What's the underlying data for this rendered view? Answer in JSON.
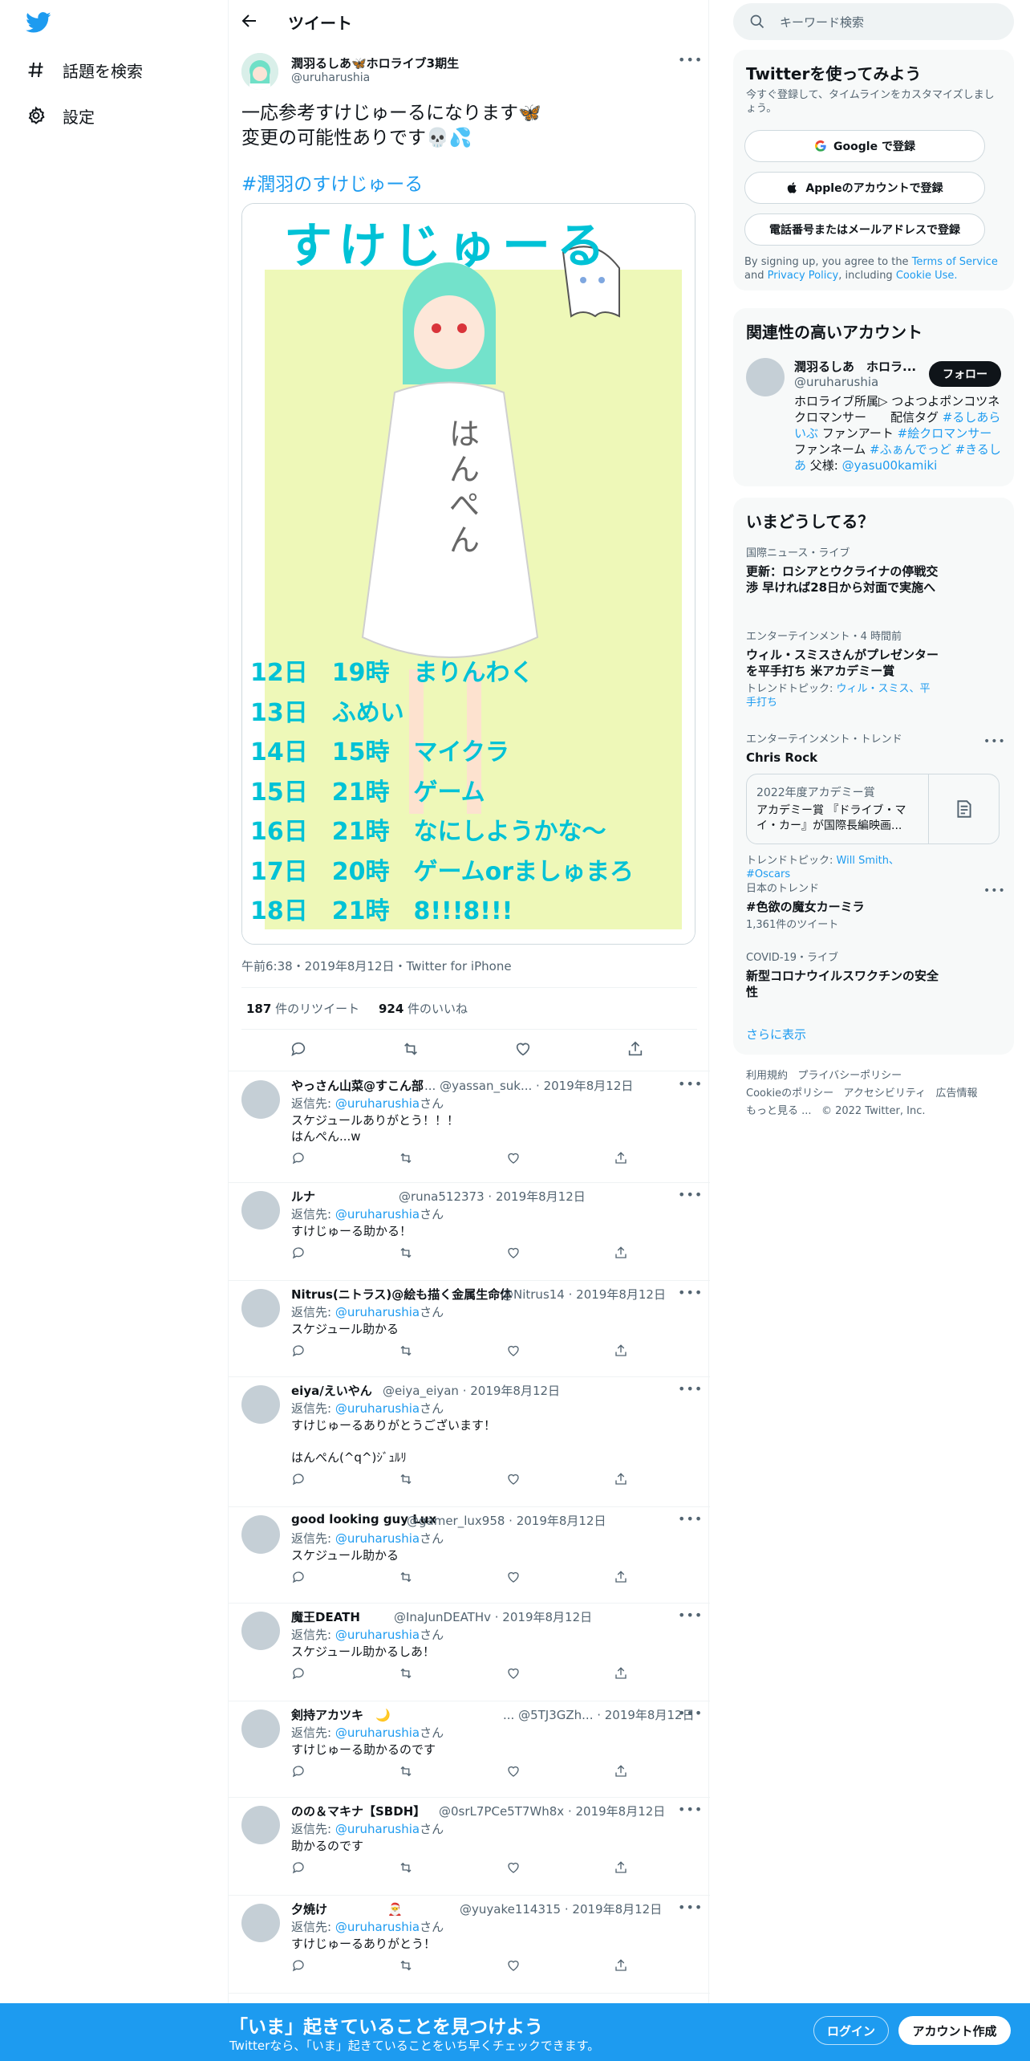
{
  "colors": {
    "accent": "#1d9bf0",
    "text": "#0f1419",
    "muted": "#536471",
    "schedule_text": "#00c2d6",
    "schedule_bg": "#eef8b8"
  },
  "nav": {
    "items": [
      {
        "label": "話題を検索",
        "icon": "hashtag-icon"
      },
      {
        "label": "設定",
        "icon": "gear-icon"
      }
    ]
  },
  "header": {
    "title": "ツイート"
  },
  "tweet": {
    "author_name": "潤羽るしあ🦋ホロライブ3期生",
    "author_handle": "@uruharushia",
    "text_line1": "一応参考すけじゅーるになります🦋",
    "text_line2": "変更の可能性ありです💀💦",
    "hashtag": "#潤羽のすけじゅーる",
    "meta": "午前6:38・2019年8月12日・Twitter for iPhone",
    "retweets": "187",
    "retweets_label": "件のリツイート",
    "likes": "924",
    "likes_label": "件のいいね",
    "image": {
      "heading": "すけじゅーる",
      "shirt_text": "はんぺん",
      "schedule": [
        "12日　19時　まりんわく",
        "13日　ふめい",
        "14日　15時　マイクラ",
        "15日　21時　ゲーム",
        "16日　21時　なにしようかな～",
        "17日　20時　ゲームorましゅまろ",
        "18日　21時　8!!!8!!!"
      ]
    }
  },
  "replies": [
    {
      "name": "やっさん山菜@すこん部",
      "handle": "... @yassan_suk... · 2019年8月12日",
      "reply_to_label": "返信先:",
      "reply_to_handle": "@uruharushia",
      "reply_to_suffix": "さん",
      "text": "スケジュールありがとう！！！\nはんぺん...w"
    },
    {
      "name": "ルナ",
      "handle": "@runa512373 · 2019年8月12日",
      "reply_to_label": "返信先:",
      "reply_to_handle": "@uruharushia",
      "reply_to_suffix": "さん",
      "text": "すけじゅーる助かる！"
    },
    {
      "name": "Nitrus(ニトラス)@絵も描く金属生命体",
      "handle": "@Nitrus14 · 2019年8月12日",
      "reply_to_label": "返信先:",
      "reply_to_handle": "@uruharushia",
      "reply_to_suffix": "さん",
      "text": "スケジュール助かる"
    },
    {
      "name": "eiya/えいやん",
      "handle": "@eiya_eiyan · 2019年8月12日",
      "reply_to_label": "返信先:",
      "reply_to_handle": "@uruharushia",
      "reply_to_suffix": "さん",
      "text": "すけじゅーるありがとうございます！\n\nはんぺん(^q^)ｼﾞｭﾙﾘ"
    },
    {
      "name": "good looking guy Lux",
      "handle": "@gamer_lux958 · 2019年8月12日",
      "reply_to_label": "返信先:",
      "reply_to_handle": "@uruharushia",
      "reply_to_suffix": "さん",
      "text": "スケジュール助かる"
    },
    {
      "name": "魔王DEATH",
      "handle": "@InaJunDEATHv · 2019年8月12日",
      "reply_to_label": "返信先:",
      "reply_to_handle": "@uruharushia",
      "reply_to_suffix": "さん",
      "text": "スケジュール助かるしあ！"
    },
    {
      "name": "剣持アカツキ　🌙",
      "handle": "... @5TJ3GZh... · 2019年8月12日",
      "reply_to_label": "返信先:",
      "reply_to_handle": "@uruharushia",
      "reply_to_suffix": "さん",
      "text": "すけじゅーる助かるのです"
    },
    {
      "name": "のの＆マキナ【SBDH】",
      "handle": "@0srL7PCe5T7Wh8x · 2019年8月12日",
      "reply_to_label": "返信先:",
      "reply_to_handle": "@uruharushia",
      "reply_to_suffix": "さん",
      "text": "助かるのです"
    },
    {
      "name": "夕焼け　　　　　🎅",
      "handle": "@yuyake114315 · 2019年8月12日",
      "reply_to_label": "返信先:",
      "reply_to_handle": "@uruharushia",
      "reply_to_suffix": "さん",
      "text": "すけじゅーるありがとう！"
    }
  ],
  "search": {
    "placeholder": "キーワード検索"
  },
  "signup": {
    "title": "Twitterを使ってみよう",
    "subtitle": "今すぐ登録して、タイムラインをカスタマイズしましょう。",
    "google": "Google で登録",
    "apple": "Appleのアカウントで登録",
    "phone": "電話番号またはメールアドレスで登録",
    "terms_pre": "By signing up, you agree to the",
    "terms_link": "Terms of Service",
    "terms_and": "and",
    "privacy_link": "Privacy Policy",
    "terms_incl": ", including",
    "cookie_link": "Cookie Use."
  },
  "related": {
    "title": "関連性の高いアカウント",
    "name": "潤羽るしあ　ホロラ...",
    "handle": "@uruharushia",
    "follow": "フォロー",
    "bio_plain1": "ホロライブ所属▷ つよつよポンコツネクロマンサー　　配信タグ",
    "bio_tag1": "#るしあらいぶ",
    "bio_plain2": " ファンアート",
    "bio_tag2": "#絵クロマンサー",
    "bio_plain3": " ファンネーム",
    "bio_tag3": "#ふぁんでっど",
    "bio_tag4": "#きるしあ",
    "bio_plain4": " 父様:",
    "bio_tag5": "@yasu00kamiki"
  },
  "trends": {
    "title": "いまどうしてる？",
    "items": [
      {
        "category": "国際ニュース・ライブ",
        "title": "更新：ロシアとウクライナの停戦交渉 早ければ28日から対面で実施へ"
      },
      {
        "category": "エンターテインメント・4 時間前",
        "title": "ウィル・スミスさんがプレゼンターを平手打ち 米アカデミー賞",
        "sub_label": "トレンドトピック:",
        "sub_link": "ウィル・スミス、平手打ち"
      },
      {
        "category": "エンターテインメント・トレンド",
        "title": "Chris Rock",
        "news_top": "2022年度アカデミー賞",
        "news_body": "アカデミー賞 『ドライブ・マイ・カー』が国際長編映画...",
        "sub_label": "トレンドトピック:",
        "sub_link": "Will Smith、#Oscars"
      },
      {
        "category": "日本のトレンド",
        "title": "#色欲の魔女カーミラ",
        "sub": "1,361件のツイート"
      },
      {
        "category": "COVID-19・ライブ",
        "title": "新型コロナウイルスワクチンの安全性"
      }
    ],
    "show_more": "さらに表示"
  },
  "footer": {
    "links": [
      "利用規約",
      "プライバシーポリシー",
      "Cookieのポリシー",
      "アクセシビリティ",
      "広告情報",
      "もっと見る ...",
      "© 2022 Twitter, Inc."
    ]
  },
  "banner": {
    "title": "「いま」起きていることを見つけよう",
    "subtitle": "Twitterなら、「いま」起きていることをいち早くチェックできます。",
    "login": "ログイン",
    "signup": "アカウント作成"
  }
}
